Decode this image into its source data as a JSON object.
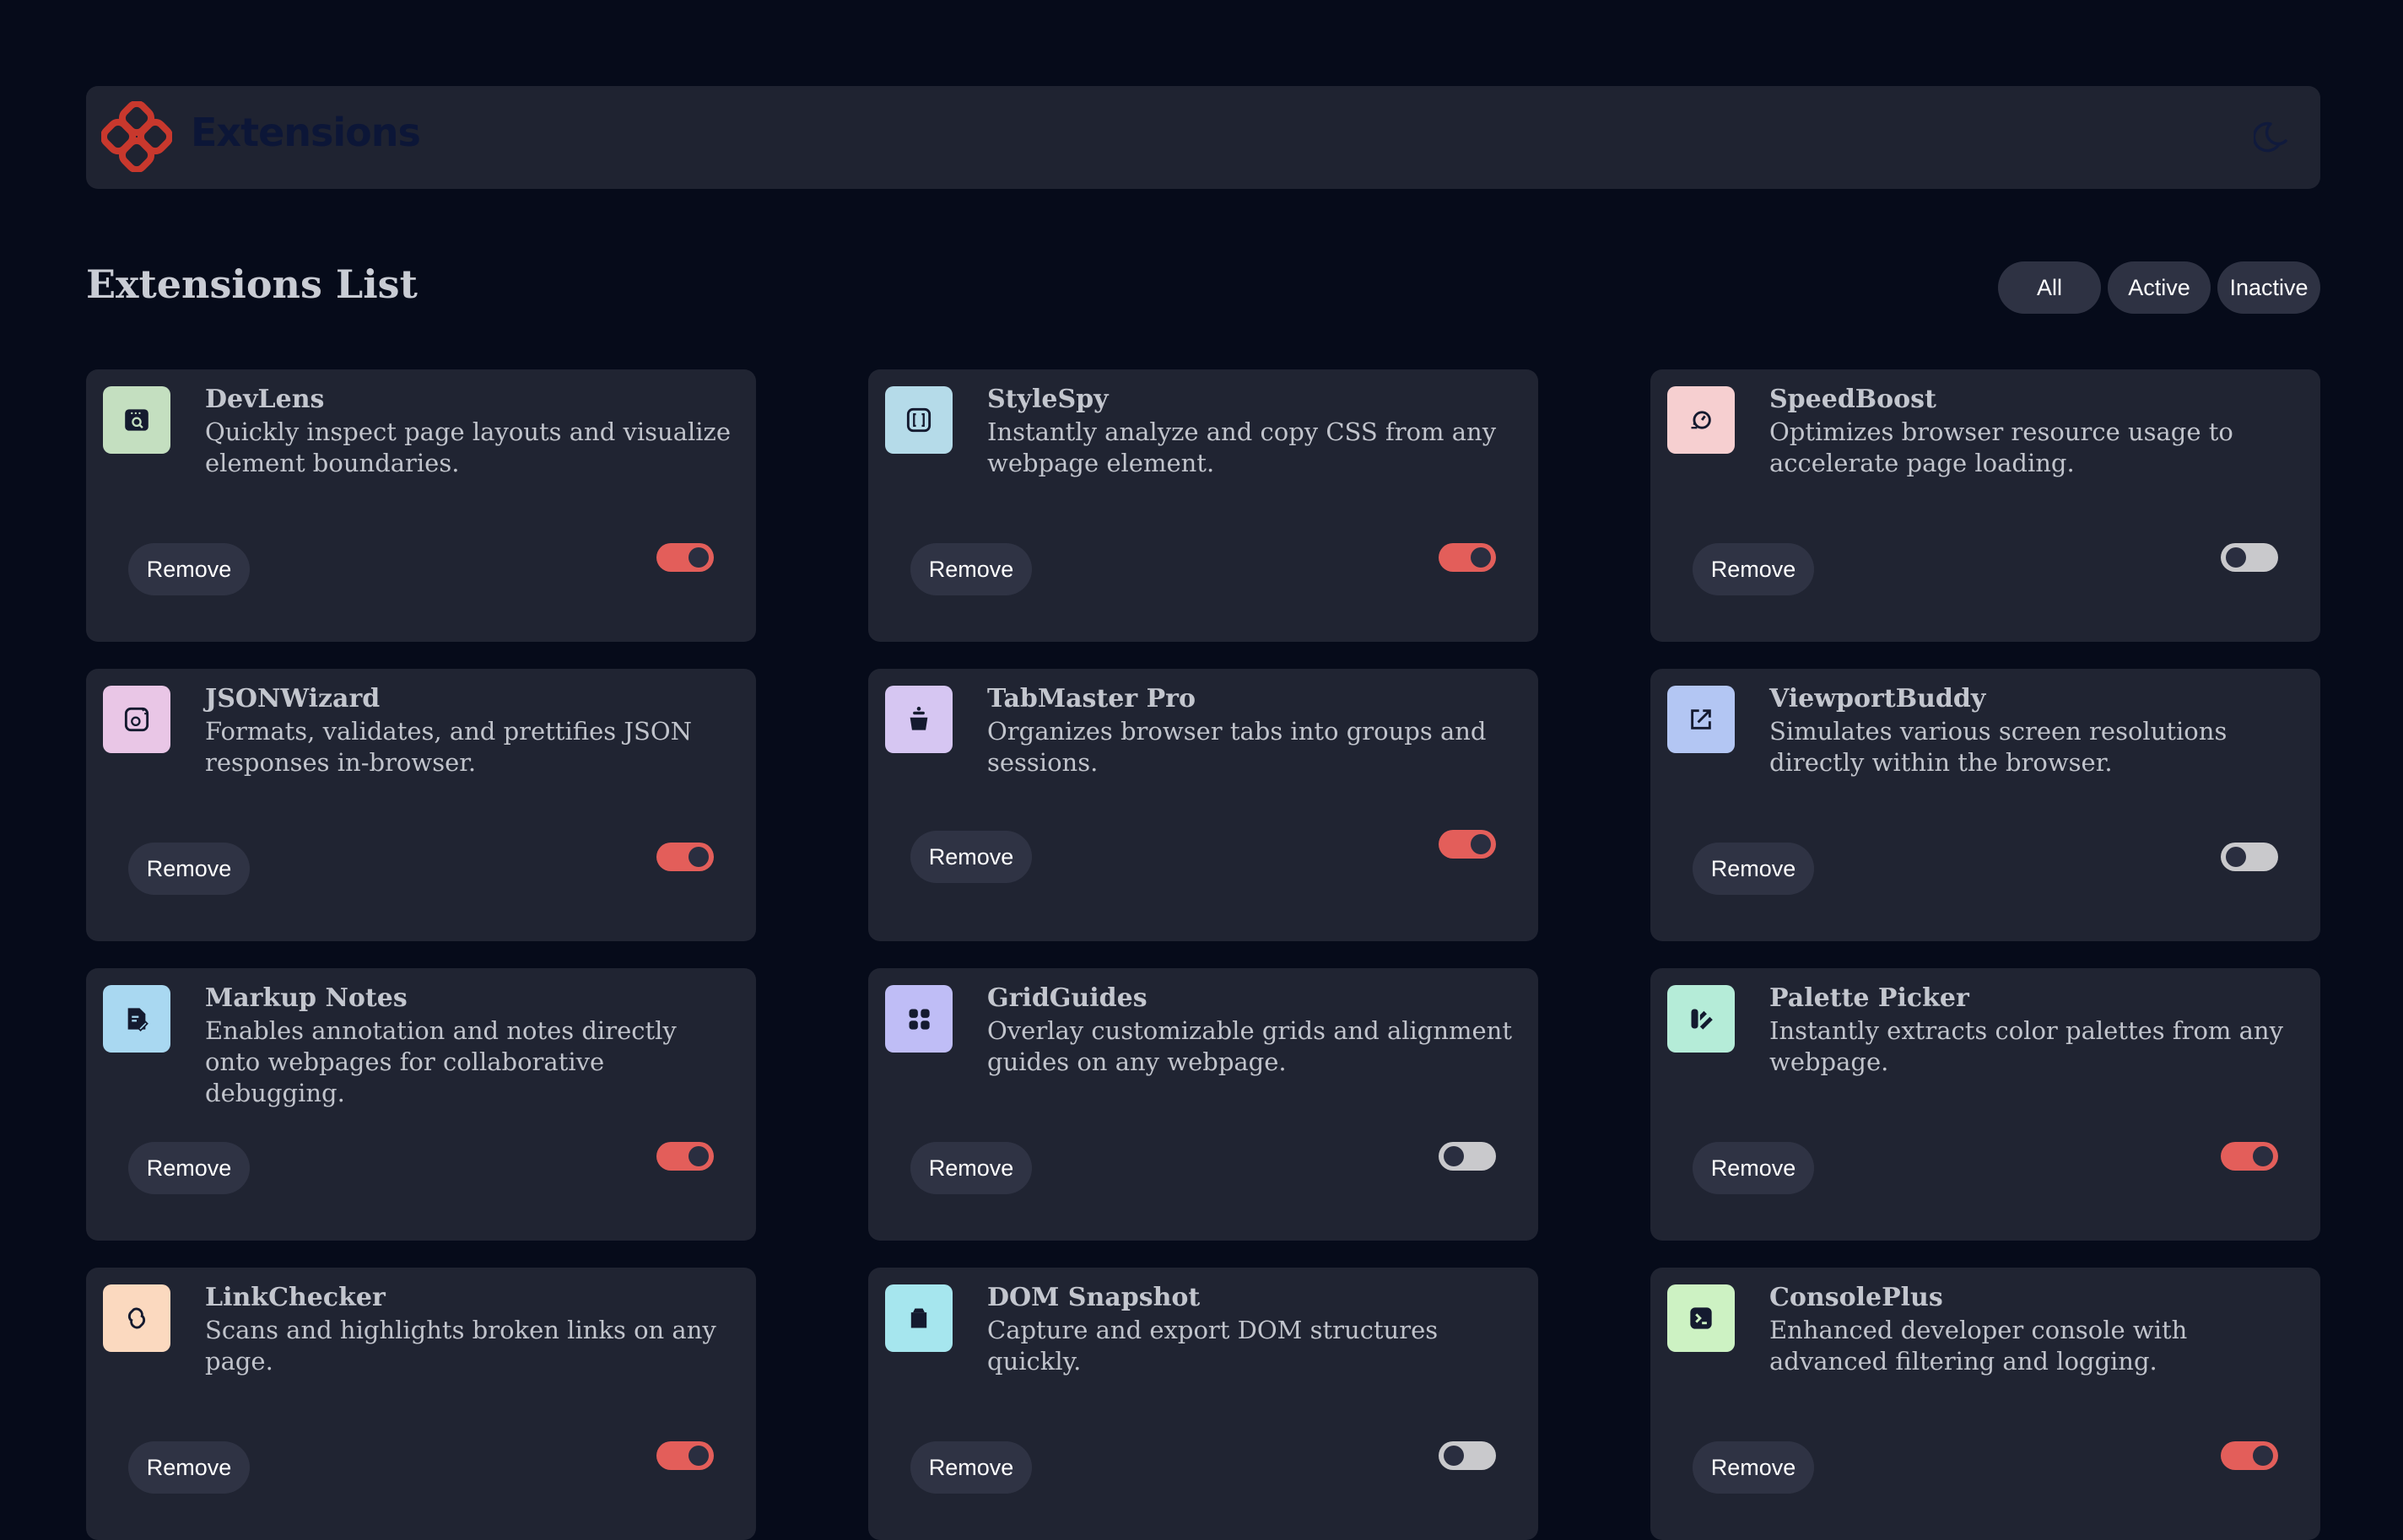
{
  "header": {
    "brand": "Extensions"
  },
  "list": {
    "title": "Extensions List",
    "filters": [
      "All",
      "Active",
      "Inactive"
    ]
  },
  "remove_label": "Remove",
  "extensions": [
    {
      "name": "DevLens",
      "desc": "Quickly inspect page layouts and visualize element boundaries.",
      "active": true,
      "icon": "devlens-icon",
      "color": "#c4dfc0"
    },
    {
      "name": "StyleSpy",
      "desc": "Instantly analyze and copy CSS from any webpage element.",
      "active": true,
      "icon": "stylespy-icon",
      "color": "#b5dbe9"
    },
    {
      "name": "SpeedBoost",
      "desc": "Optimizes browser resource usage to accelerate page loading.",
      "active": false,
      "icon": "speedboost-icon",
      "color": "#f6cfd0"
    },
    {
      "name": "JSONWizard",
      "desc": "Formats, validates, and prettifies JSON responses in-browser.",
      "active": true,
      "icon": "jsonwizard-icon",
      "color": "#e9c6e6"
    },
    {
      "name": "TabMaster Pro",
      "desc": "Organizes browser tabs into groups and sessions.",
      "active": true,
      "icon": "tabmaster-icon",
      "color": "#d6c6f2"
    },
    {
      "name": "ViewportBuddy",
      "desc": "Simulates various screen resolutions directly within the browser.",
      "active": false,
      "icon": "viewportbuddy-icon",
      "color": "#b3c6f3"
    },
    {
      "name": "Markup Notes",
      "desc": "Enables annotation and notes directly onto webpages for collaborative debugging.",
      "active": true,
      "icon": "markupnotes-icon",
      "color": "#a9d8f1"
    },
    {
      "name": "GridGuides",
      "desc": "Overlay customizable grids and alignment guides on any webpage.",
      "active": false,
      "icon": "gridguides-icon",
      "color": "#bfbdf6"
    },
    {
      "name": "Palette Picker",
      "desc": "Instantly extracts color palettes from any webpage.",
      "active": true,
      "icon": "palettepicker-icon",
      "color": "#b5ecd8"
    },
    {
      "name": "LinkChecker",
      "desc": "Scans and highlights broken links on any page.",
      "active": true,
      "icon": "linkchecker-icon",
      "color": "#fbd9bf"
    },
    {
      "name": "DOM Snapshot",
      "desc": "Capture and export DOM structures quickly.",
      "active": false,
      "icon": "domsnapshot-icon",
      "color": "#a6e6ee"
    },
    {
      "name": "ConsolePlus",
      "desc": "Enhanced developer console with advanced filtering and logging.",
      "active": true,
      "icon": "consoleplus-icon",
      "color": "#cdf2c3"
    }
  ],
  "colors": {
    "background": "#060b1a",
    "card": "#202432",
    "accent": "#e35e5a",
    "logo": "#c8382d"
  }
}
